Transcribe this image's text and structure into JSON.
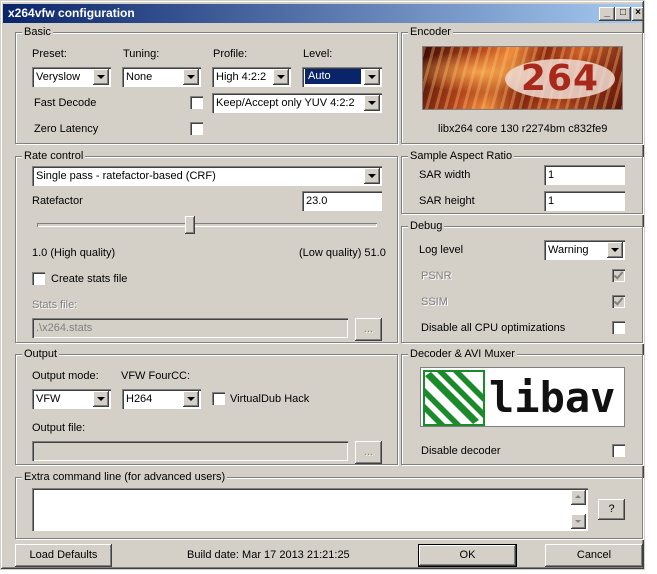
{
  "window": {
    "title": "x264vfw configuration",
    "minimize_glyph": "_",
    "maximize_glyph": "□",
    "close_glyph": "×"
  },
  "basic": {
    "title": "Basic",
    "preset": {
      "label": "Preset:",
      "value": "Veryslow"
    },
    "tuning": {
      "label": "Tuning:",
      "value": "None"
    },
    "profile": {
      "label": "Profile:",
      "value": "High 4:2:2"
    },
    "level": {
      "label": "Level:",
      "value": "Auto"
    },
    "fast_decode": {
      "label": "Fast Decode",
      "checked": false
    },
    "zero_latency": {
      "label": "Zero Latency",
      "checked": false
    },
    "colorspace": {
      "value": "Keep/Accept only YUV 4:2:2"
    }
  },
  "encoder": {
    "title": "Encoder",
    "logo_text": "264",
    "version": "libx264 core 130 r2274bm c832fe9"
  },
  "rate_control": {
    "title": "Rate control",
    "mode": "Single pass - ratefactor-based (CRF)",
    "ratefactor_label": "Ratefactor",
    "ratefactor_value": "23.0",
    "ratefactor_fraction": 0.45,
    "slider_min_label": "1.0 (High quality)",
    "slider_max_label": "(Low quality) 51.0",
    "create_stats": {
      "label": "Create stats file",
      "checked": false
    },
    "stats_file_label": "Stats file:",
    "stats_file_value": ".\\x264.stats",
    "browse_label": "..."
  },
  "sar": {
    "title": "Sample Aspect Ratio",
    "width_label": "SAR width",
    "width_value": "1",
    "height_label": "SAR height",
    "height_value": "1"
  },
  "debug": {
    "title": "Debug",
    "log_level_label": "Log level",
    "log_level_value": "Warning",
    "psnr_label": "PSNR",
    "psnr_checked": true,
    "ssim_label": "SSIM",
    "ssim_checked": true,
    "disable_cpu_label": "Disable all CPU optimizations",
    "disable_cpu_checked": false
  },
  "output": {
    "title": "Output",
    "mode_label": "Output mode:",
    "mode_value": "VFW",
    "fourcc_label": "VFW FourCC:",
    "fourcc_value": "H264",
    "vdub_hack": {
      "label": "VirtualDub Hack",
      "checked": false
    },
    "file_label": "Output file:",
    "file_value": "",
    "browse_label": "..."
  },
  "decoder": {
    "title": "Decoder & AVI Muxer",
    "logo_text": "libav",
    "disable_decoder_label": "Disable decoder",
    "disable_decoder_checked": false
  },
  "extra": {
    "title": "Extra command line (for advanced users)",
    "value": "",
    "help_label": "?"
  },
  "footer": {
    "load_defaults_label": "Load Defaults",
    "build_date": "Build date: Mar 17 2013 21:21:25",
    "ok_label": "OK",
    "cancel_label": "Cancel"
  }
}
